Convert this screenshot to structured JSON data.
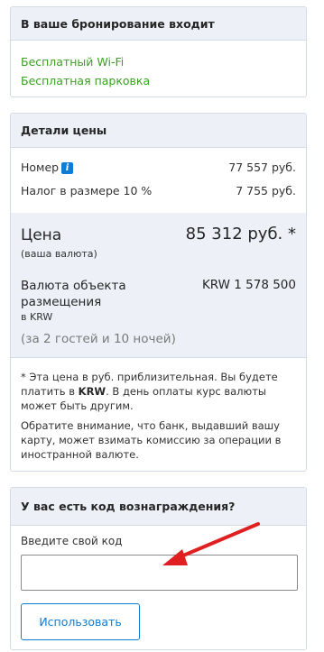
{
  "booking_includes": {
    "title": "В ваше бронирование входит",
    "items": [
      "Бесплатный Wi-Fi",
      "Бесплатная парковка"
    ]
  },
  "price_details": {
    "title": "Детали цены",
    "room_label": "Номер",
    "room_value": "77 557 руб.",
    "tax_label": "Налог в размере 10 %",
    "tax_value": "7 755 руб.",
    "price_label": "Цена",
    "price_sublabel": "(ваша валюта)",
    "price_value": "85 312 руб. *",
    "property_currency_label": "Валюта объекта размещения",
    "property_currency_sublabel": "в KRW",
    "property_currency_value": "KRW 1 578 500",
    "guests_nights": "(за 2 гостей и 10 ночей)",
    "note1_a": "*  Эта цена в руб. приблизительная. Вы будете платить в ",
    "note1_b": "KRW",
    "note1_c": ". В день оплаты курс валюты может быть другим.",
    "note2": "Обратите внимание, что банк, выдавший вашу карту, может взимать комиссию за операции в иностранной валюте."
  },
  "reward_code": {
    "title": "У вас есть код вознаграждения?",
    "input_label": "Введите свой код",
    "input_value": "",
    "button_label": "Использовать"
  },
  "colors": {
    "accent": "#0e7cd6",
    "green": "#3a9f22",
    "panel": "#edf0f7",
    "arrow": "#e02020"
  },
  "icons": [
    "info-icon",
    "arrow-annotation"
  ]
}
